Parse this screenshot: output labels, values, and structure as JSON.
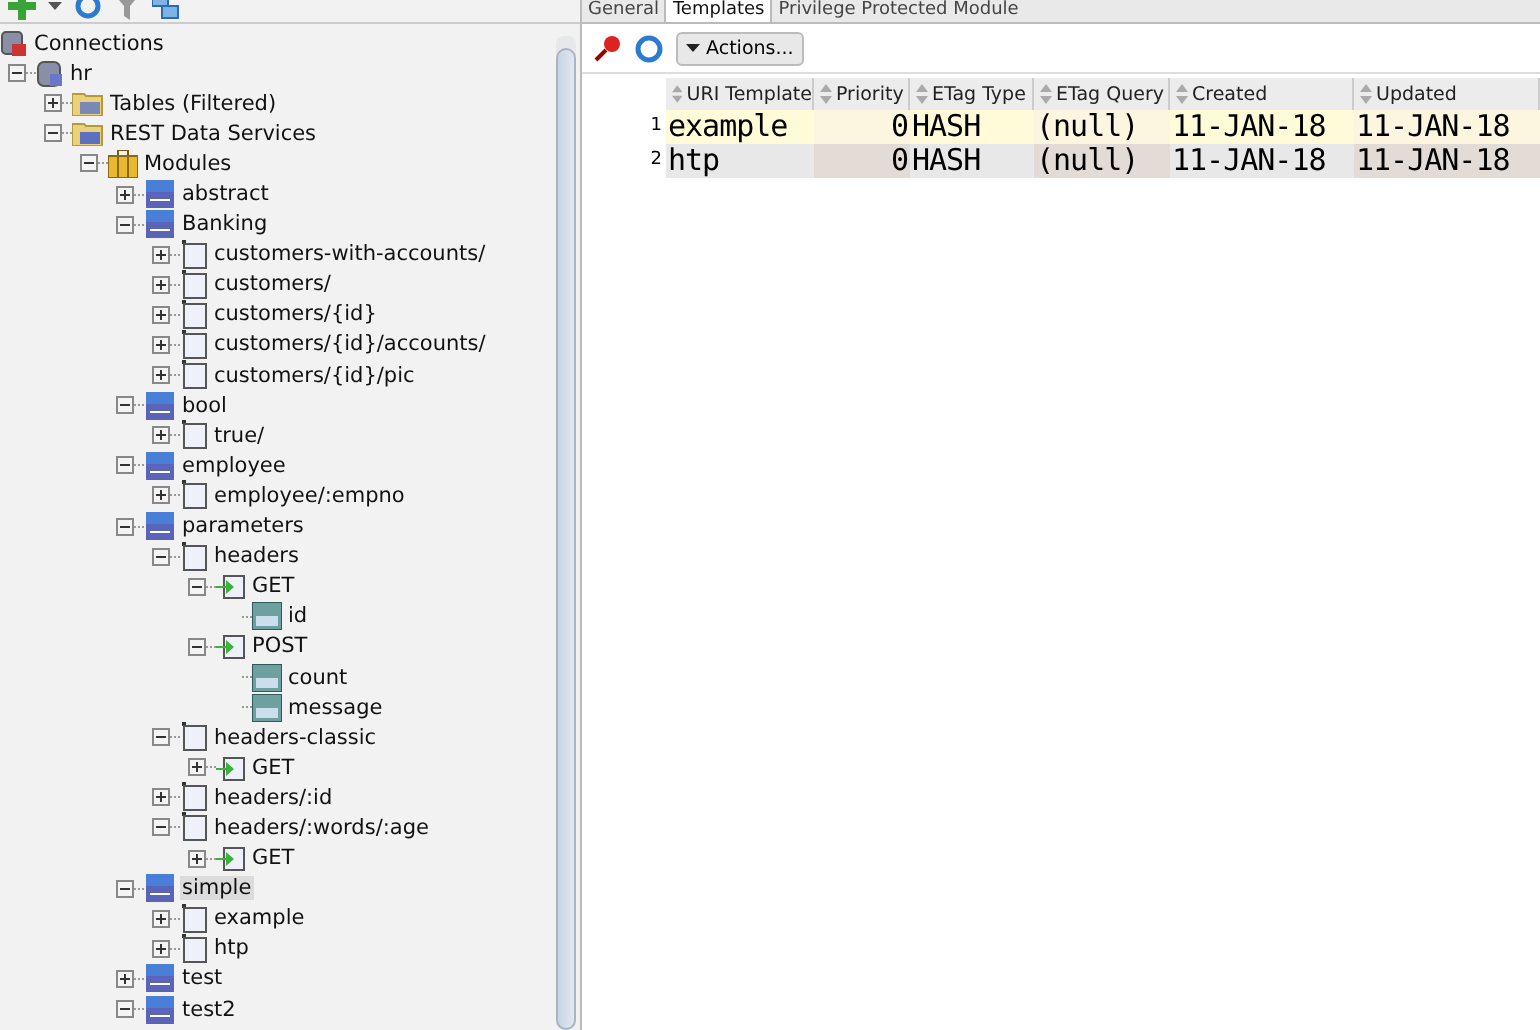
{
  "navigator": {
    "title": "Connections",
    "tree": [
      {
        "label": "hr",
        "kind": "database",
        "expanded": true,
        "selected": false,
        "children": [
          {
            "label": "Tables (Filtered)",
            "kind": "tables-folder",
            "expanded": false,
            "selected": false
          },
          {
            "label": "REST Data Services",
            "kind": "rest-folder",
            "expanded": true,
            "selected": false,
            "children": [
              {
                "label": "Modules",
                "kind": "modules",
                "expanded": true,
                "selected": false,
                "children": [
                  {
                    "label": "abstract",
                    "kind": "module",
                    "expanded": false,
                    "selected": false
                  },
                  {
                    "label": "Banking",
                    "kind": "module",
                    "expanded": true,
                    "selected": false,
                    "children": [
                      {
                        "label": "customers-with-accounts/",
                        "kind": "template",
                        "expanded": false,
                        "selected": false
                      },
                      {
                        "label": "customers/",
                        "kind": "template",
                        "expanded": false,
                        "selected": false
                      },
                      {
                        "label": "customers/{id}",
                        "kind": "template",
                        "expanded": false,
                        "selected": false
                      },
                      {
                        "label": "customers/{id}/accounts/",
                        "kind": "template",
                        "expanded": false,
                        "selected": false
                      },
                      {
                        "label": "customers/{id}/pic",
                        "kind": "template",
                        "expanded": false,
                        "selected": false
                      }
                    ]
                  },
                  {
                    "label": "bool",
                    "kind": "module",
                    "expanded": true,
                    "selected": false,
                    "children": [
                      {
                        "label": "true/",
                        "kind": "template",
                        "expanded": false,
                        "selected": false
                      }
                    ]
                  },
                  {
                    "label": "employee",
                    "kind": "module",
                    "expanded": true,
                    "selected": false,
                    "children": [
                      {
                        "label": "employee/:empno",
                        "kind": "template",
                        "expanded": false,
                        "selected": false
                      }
                    ]
                  },
                  {
                    "label": "parameters",
                    "kind": "module",
                    "expanded": true,
                    "selected": false,
                    "children": [
                      {
                        "label": "headers",
                        "kind": "template",
                        "expanded": true,
                        "selected": false,
                        "children": [
                          {
                            "label": "GET",
                            "kind": "handler",
                            "expanded": true,
                            "selected": false,
                            "children": [
                              {
                                "label": "id",
                                "kind": "parameter",
                                "selected": false
                              }
                            ]
                          },
                          {
                            "label": "POST",
                            "kind": "handler",
                            "expanded": true,
                            "selected": false,
                            "children": [
                              {
                                "label": "count",
                                "kind": "parameter",
                                "selected": false
                              },
                              {
                                "label": "message",
                                "kind": "parameter",
                                "selected": false
                              }
                            ]
                          }
                        ]
                      },
                      {
                        "label": "headers-classic",
                        "kind": "template",
                        "expanded": true,
                        "selected": false,
                        "children": [
                          {
                            "label": "GET",
                            "kind": "handler",
                            "expanded": false,
                            "selected": false
                          }
                        ]
                      },
                      {
                        "label": "headers/:id",
                        "kind": "template",
                        "expanded": false,
                        "selected": false
                      },
                      {
                        "label": "headers/:words/:age",
                        "kind": "template",
                        "expanded": true,
                        "selected": false,
                        "children": [
                          {
                            "label": "GET",
                            "kind": "handler",
                            "expanded": false,
                            "selected": false
                          }
                        ]
                      }
                    ]
                  },
                  {
                    "label": "simple",
                    "kind": "module",
                    "expanded": true,
                    "selected": true,
                    "children": [
                      {
                        "label": "example",
                        "kind": "template",
                        "expanded": false,
                        "selected": false
                      },
                      {
                        "label": "htp",
                        "kind": "template",
                        "expanded": false,
                        "selected": false
                      }
                    ]
                  },
                  {
                    "label": "test",
                    "kind": "module",
                    "expanded": false,
                    "selected": false
                  },
                  {
                    "label": "test2",
                    "kind": "module",
                    "expanded": true,
                    "selected": false
                  }
                ]
              }
            ]
          }
        ]
      }
    ]
  },
  "tabs": [
    {
      "label": "General",
      "selected": false
    },
    {
      "label": "Templates",
      "selected": true
    },
    {
      "label": "Privilege Protected Module",
      "selected": false
    }
  ],
  "actions_button": "Actions...",
  "table": {
    "columns": [
      "URI Template",
      "Priority",
      "ETag Type",
      "ETag Query",
      "Created",
      "Updated"
    ],
    "rows": [
      {
        "number": "1",
        "selected": true,
        "cells": [
          "example",
          "0",
          "HASH",
          "(null)",
          "11-JAN-18",
          "11-JAN-18"
        ]
      },
      {
        "number": "2",
        "selected": false,
        "cells": [
          "htp",
          "0",
          "HASH",
          "(null)",
          "11-JAN-18",
          "11-JAN-18"
        ]
      }
    ]
  }
}
